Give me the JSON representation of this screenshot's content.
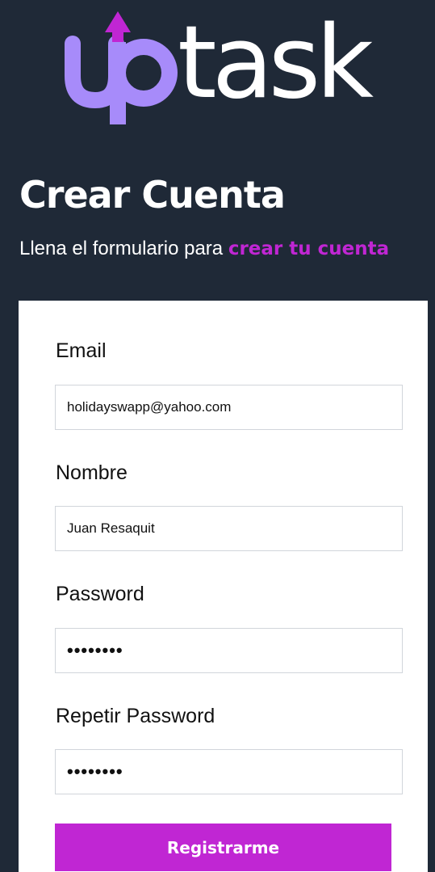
{
  "brand": {
    "logo_text_up": "up",
    "logo_text_task": "task",
    "colors": {
      "up_purple": "#a78bfa",
      "arrow_magenta": "#c026d3",
      "background": "#1f2937"
    }
  },
  "header": {
    "title": "Crear Cuenta",
    "subtitle_prefix": "Llena el formulario para ",
    "subtitle_accent": "crear tu cuenta",
    "accent_color": "#c026d3"
  },
  "form": {
    "email": {
      "label": "Email",
      "value": "holidayswapp@yahoo.com"
    },
    "name": {
      "label": "Nombre",
      "value": "Juan Resaquit"
    },
    "password": {
      "label": "Password",
      "value": "••••••••"
    },
    "password_repeat": {
      "label": "Repetir Password",
      "value": "••••••••"
    },
    "submit_label": "Registrarme"
  }
}
